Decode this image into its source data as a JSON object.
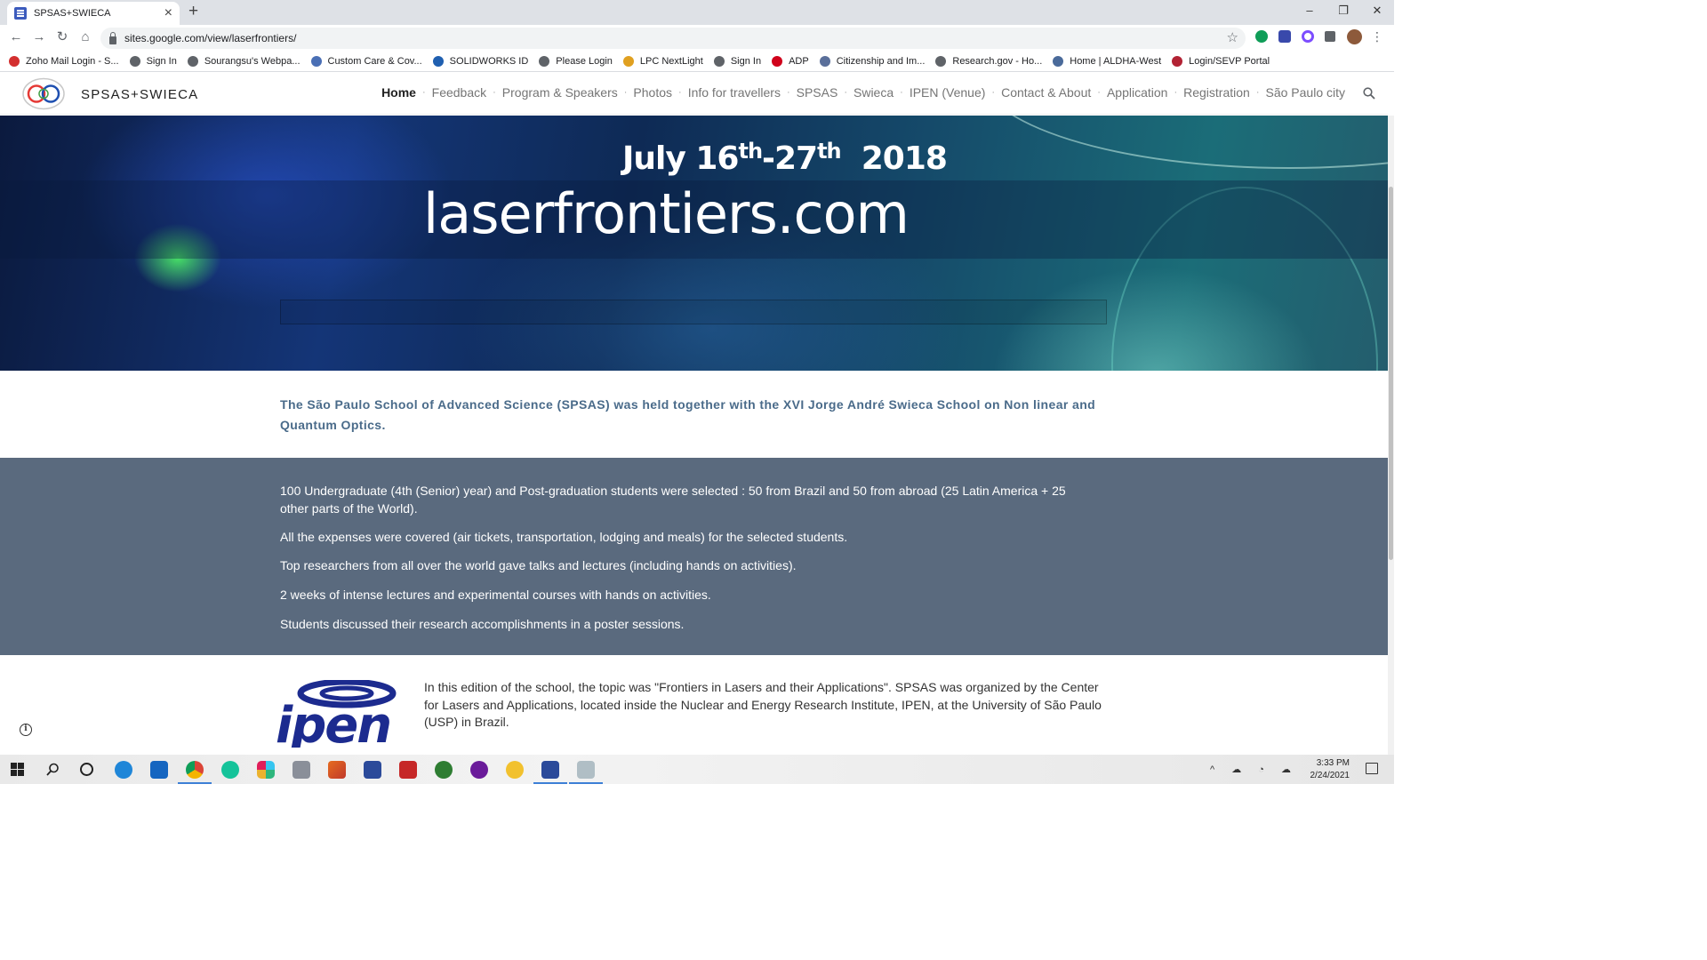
{
  "browser": {
    "tab_title": "SPSAS+SWIECA",
    "url": "sites.google.com/view/laserfrontiers/",
    "bookmarks": [
      {
        "label": "Zoho Mail Login - S...",
        "color": "#d32f2f"
      },
      {
        "label": "Sign In",
        "color": "#5f6368"
      },
      {
        "label": "Sourangsu's Webpa...",
        "color": "#5f6368"
      },
      {
        "label": "Custom Care & Cov...",
        "color": "#4a6fb5"
      },
      {
        "label": "SOLIDWORKS ID",
        "color": "#1f5fb0"
      },
      {
        "label": "Please Login",
        "color": "#5f6368"
      },
      {
        "label": "LPC NextLight",
        "color": "#e0a020"
      },
      {
        "label": "Sign In",
        "color": "#5f6368"
      },
      {
        "label": "ADP",
        "color": "#d0021b"
      },
      {
        "label": "Citizenship and Im...",
        "color": "#5a6f9a"
      },
      {
        "label": "Research.gov - Ho...",
        "color": "#5f6368"
      },
      {
        "label": "Home | ALDHA-West",
        "color": "#4a6a9a"
      },
      {
        "label": "Login/SEVP Portal",
        "color": "#b22234"
      }
    ]
  },
  "site": {
    "title": "SPSAS+SWIECA",
    "nav": [
      "Home",
      "Feedback",
      "Program & Speakers",
      "Photos",
      "Info for travellers",
      "SPSAS",
      "Swieca",
      "IPEN (Venue)",
      "Contact & About",
      "Application",
      "Registration",
      "São Paulo city"
    ],
    "nav_separator": "·"
  },
  "hero": {
    "date_month": "July 16",
    "date_sup1": "th",
    "date_mid": "-27",
    "date_sup2": "th",
    "date_year": "2018",
    "website": "laserfrontiers.com"
  },
  "intro": "The São Paulo School of Advanced Science (SPSAS) was held together with the XVI Jorge André Swieca School on Non linear and Quantum Optics.",
  "facts": [
    "100 Undergraduate (4th (Senior) year) and Post-graduation students were selected : 50 from Brazil and 50 from abroad (25 Latin America + 25 other parts of the World).",
    "All the expenses were covered (air tickets, transportation, lodging and meals) for the selected students.",
    "Top researchers from all over the world gave talks and lectures (including hands on activities).",
    "2 weeks of intense lectures and experimental courses with hands on activities.",
    "Students discussed their research accomplishments in a poster sessions."
  ],
  "ipen": {
    "logo_text": "ipen",
    "text": "In this edition of the school, the topic was \"Frontiers in Lasers and their Applications\". SPSAS was organized by the Center for Lasers and Applications, located inside the Nuclear and Energy Research Institute, IPEN, at the University of São Paulo (USP) in Brazil."
  },
  "taskbar": {
    "time": "3:33 PM",
    "date": "2/24/2021"
  },
  "colors": {
    "facts_bg": "#5a6a7e",
    "intro_text": "#4a6b8a",
    "ipen_blue": "#1c2b8f"
  }
}
